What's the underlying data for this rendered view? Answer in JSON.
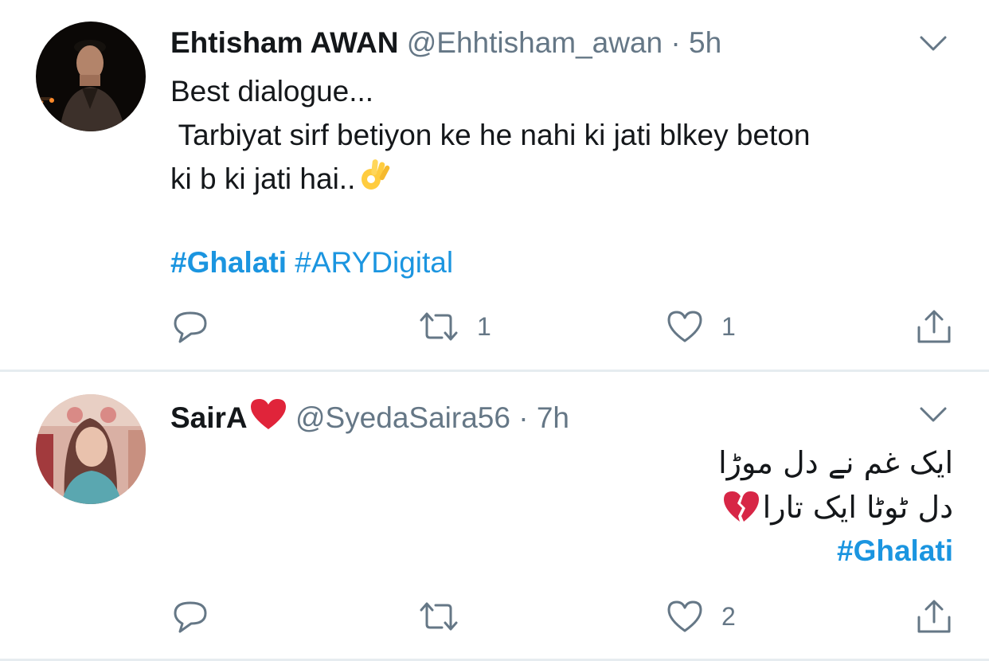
{
  "colors": {
    "link": "#1b95e0",
    "secondary_text": "#657786",
    "primary_text": "#14171a",
    "divider": "#e6ecf0",
    "heart_red": "#e0245e"
  },
  "tweets": [
    {
      "display_name": "Ehtisham AWAN",
      "handle": "@Ehhtisham_awan",
      "separator": "·",
      "time": "5h",
      "body_lines": [
        "Best dialogue...",
        " Tarbiyat sirf betiyon ke he nahi ki jati blkey beton",
        "ki b ki jati hai.."
      ],
      "body_emoji": "ok-hand-emoji",
      "hashtags": [
        "#Ghalati",
        "#ARYDigital"
      ],
      "actions": {
        "reply_icon": "reply-icon",
        "retweet_icon": "retweet-icon",
        "retweet_count": "1",
        "like_icon": "heart-icon",
        "like_count": "1",
        "share_icon": "share-icon"
      }
    },
    {
      "display_name": "SairA",
      "name_emoji": "red-heart-emoji",
      "handle": "@SyedaSaira56",
      "separator": "·",
      "time": "7h",
      "urdu_lines": [
        "ایک غم نے دل موڑا",
        "دل ٹوٹا ایک تارا"
      ],
      "body_emoji": "broken-heart-emoji",
      "hashtag": "#Ghalati",
      "actions": {
        "reply_icon": "reply-icon",
        "retweet_icon": "retweet-icon",
        "retweet_count": "",
        "like_icon": "heart-icon",
        "like_count": "2",
        "share_icon": "share-icon"
      }
    }
  ]
}
